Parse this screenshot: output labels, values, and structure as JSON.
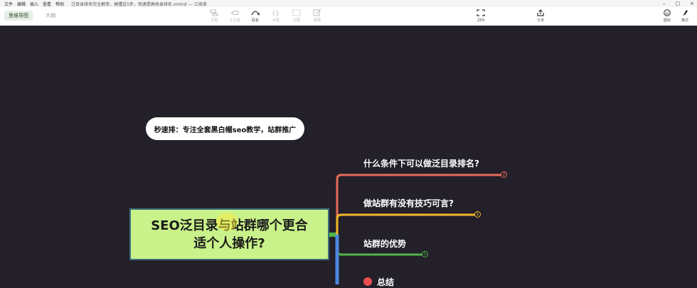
{
  "menu": [
    "文件",
    "编辑",
    "插入",
    "查看",
    "帮助"
  ],
  "window_title": "泛目录排名完全解密，搞懂这5步，快速提高收录排名.xmind --- 三阅读",
  "window_controls": [
    "–",
    "□",
    "×"
  ],
  "view_tabs": {
    "mindmap": "思维导图",
    "outline": "大纲"
  },
  "toolbar": {
    "topic": "主题",
    "subtopic": "子主题",
    "relation": "联系",
    "outline_box": "外框",
    "boundary": "边框",
    "summary": "概要",
    "zen": "ZEN",
    "share": "分享",
    "icon_tool": "图标",
    "format": "格式"
  },
  "float_topic": "秒速排：专注全套黑白帽seo教学，站群推广",
  "central_topic": "SEO泛目录与站群哪个更合\n适个人操作?",
  "branches": [
    {
      "label": "什么条件下可以做泛目录排名?",
      "count": "2",
      "color": "#e86a5a"
    },
    {
      "label": "做站群有没有技巧可言?",
      "count": "1",
      "color": "#f2b82a"
    },
    {
      "label": "站群的优势",
      "count": "1",
      "color": "#4fb348"
    }
  ],
  "summary_branch": {
    "label": "总结",
    "color": "#4b88de"
  }
}
